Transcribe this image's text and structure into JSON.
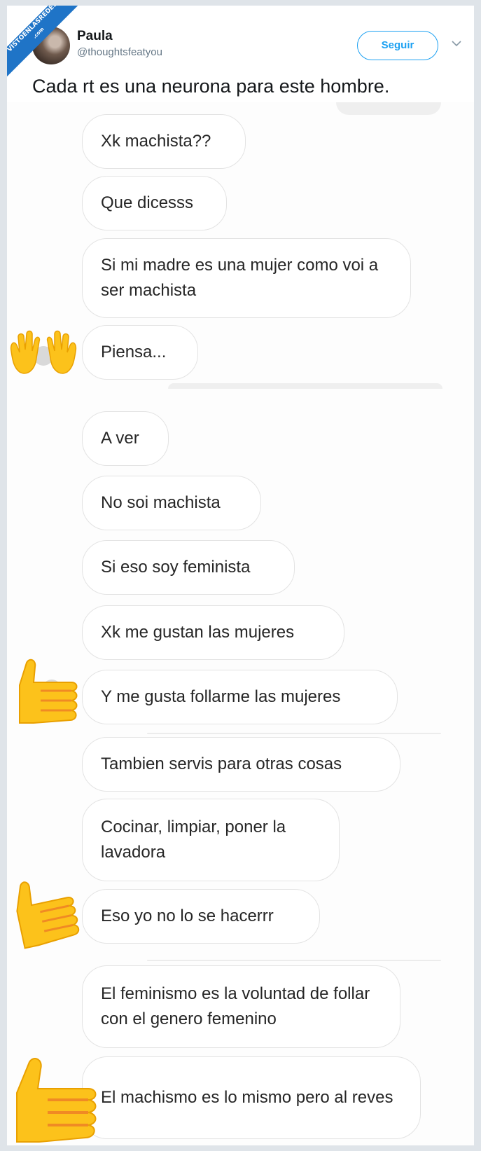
{
  "watermark": {
    "line1": "VISTOENLASREDES",
    "line2": ".com"
  },
  "tweet": {
    "author_name": "Paula",
    "author_handle": "@thoughtsfeatyou",
    "follow_label": "Seguir",
    "text": "Cada rt es una neurona para este hombre."
  },
  "chat": {
    "messages": [
      "Xk machista??",
      "Que dicesss",
      "Si mi madre es una mujer como voi a ser machista",
      "Piensa...",
      "A ver",
      "No soi machista",
      "Si eso soy feminista",
      "Xk me gustan las mujeres",
      "Y me gusta follarme las mujeres",
      "Tambien servis para otras cosas",
      "Cocinar, limpiar, poner la lavadora",
      "Eso yo no lo se hacerrr",
      "El feminismo es la voluntad de follar con el genero femenino",
      "El machismo es lo mismo pero al reves"
    ],
    "emojis": [
      "raised-hands-emoji",
      "thumbs-up-emoji",
      "thumbs-up-emoji",
      "thumbs-up-emoji"
    ]
  },
  "colors": {
    "accent": "#1da1f2",
    "bubble_border": "#e3e3e3",
    "emoji_yellow": "#fcc21b"
  }
}
